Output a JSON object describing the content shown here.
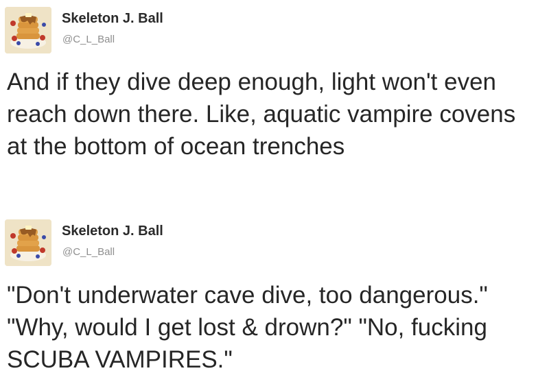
{
  "tweets": [
    {
      "display_name": "Skeleton J. Ball",
      "handle": "@C_L_Ball",
      "avatar_icon": "pancake-stack-icon",
      "text": "And if they dive deep enough, light won't even reach down there. Like, aquatic vampire covens at the bottom of ocean trenches"
    },
    {
      "display_name": "Skeleton J. Ball",
      "handle": "@C_L_Ball",
      "avatar_icon": "pancake-stack-icon",
      "text": "\"Don't underwater cave dive, too dangerous.\" \"Why, would I get lost & drown?\" \"No, fucking SCUBA VAMPIRES.\""
    }
  ],
  "colors": {
    "text": "#262626",
    "handle": "#8e8e8e",
    "avatar_bg": "#efe3c6"
  }
}
